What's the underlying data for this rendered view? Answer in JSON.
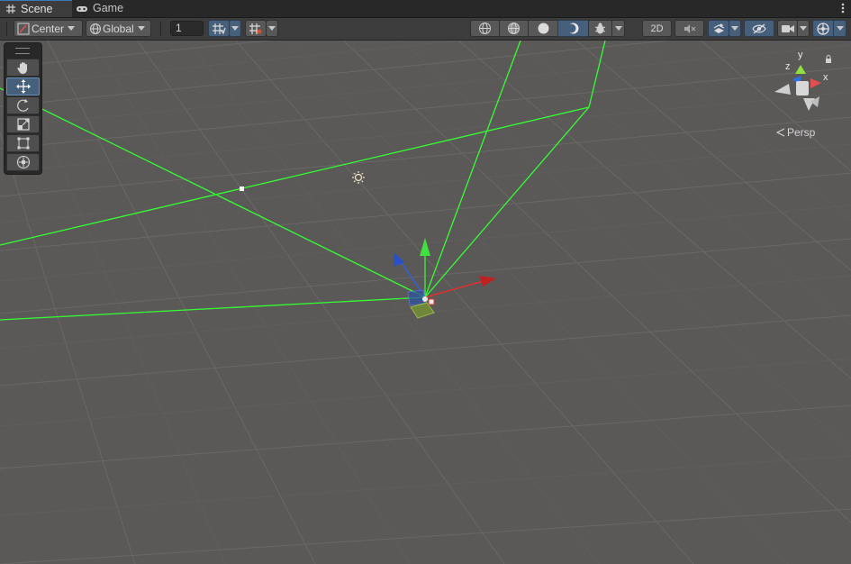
{
  "tabs": [
    {
      "label": "Scene",
      "icon": "grid-icon",
      "active": true
    },
    {
      "label": "Game",
      "icon": "gamepad-icon",
      "active": false
    }
  ],
  "toolbar": {
    "pivot_mode": "Center",
    "pivot_rotation": "Global",
    "grid_size_value": "1",
    "mode_2d_label": "2D",
    "draw_modes": [
      "wireframe-icon",
      "shaded-wireframe-icon",
      "shaded-icon",
      "unlit-icon"
    ],
    "right_icons": [
      "audio-icon",
      "effects-icon",
      "visibility-icon",
      "camera-icon",
      "gizmos-icon"
    ]
  },
  "tools": [
    "hand-tool",
    "move-tool",
    "rotate-tool",
    "scale-tool",
    "rect-tool",
    "transform-tool"
  ],
  "active_tool": "move-tool",
  "gizmo": {
    "axes": {
      "x": "x",
      "y": "y",
      "z": "z"
    },
    "projection_label": "Persp"
  },
  "colors": {
    "scene_bg": "#5b5858",
    "grid_line": "#6e6b6b",
    "camera_frustum": "#33ff33",
    "axis_x": "#e03030",
    "axis_y": "#40e040",
    "axis_z": "#3060e0",
    "accent": "#46607c"
  }
}
